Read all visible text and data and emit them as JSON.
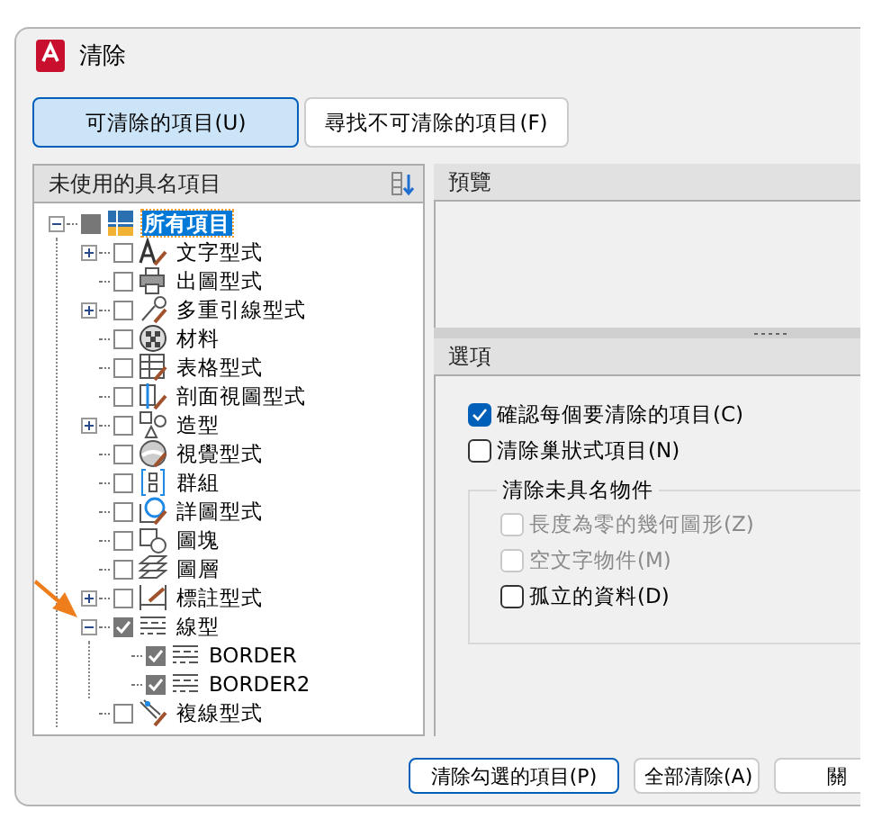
{
  "window": {
    "title": "清除"
  },
  "tabs": [
    {
      "label": "可清除的項目(U)",
      "selected": true
    },
    {
      "label": "尋找不可清除的項目(F)",
      "selected": false
    }
  ],
  "tree": {
    "header": "未使用的具名項目",
    "items": [
      {
        "label": "所有項目",
        "kind": "root",
        "checked": false,
        "indeterminate": true,
        "expanded": true,
        "selected": true,
        "children": [
          {
            "label": "文字型式",
            "kind": "text",
            "checked": false,
            "expanded": false,
            "selected": false
          },
          {
            "label": "出圖型式",
            "kind": "plot",
            "checked": false,
            "selected": false
          },
          {
            "label": "多重引線型式",
            "kind": "mleader",
            "checked": false,
            "expanded": false,
            "selected": false
          },
          {
            "label": "材料",
            "kind": "material",
            "checked": false,
            "selected": false
          },
          {
            "label": "表格型式",
            "kind": "table",
            "checked": false,
            "selected": false
          },
          {
            "label": "剖面視圖型式",
            "kind": "section",
            "checked": false,
            "selected": false
          },
          {
            "label": "造型",
            "kind": "shape",
            "checked": false,
            "expanded": false,
            "selected": false
          },
          {
            "label": "視覺型式",
            "kind": "visual",
            "checked": false,
            "selected": false
          },
          {
            "label": "群組",
            "kind": "group",
            "checked": false,
            "selected": false
          },
          {
            "label": "詳圖型式",
            "kind": "detail",
            "checked": false,
            "selected": false
          },
          {
            "label": "圖塊",
            "kind": "block",
            "checked": false,
            "selected": false
          },
          {
            "label": "圖層",
            "kind": "layer",
            "checked": false,
            "selected": false
          },
          {
            "label": "標註型式",
            "kind": "dim",
            "checked": false,
            "expanded": false,
            "selected": false
          },
          {
            "label": "線型",
            "kind": "linetype",
            "checked": true,
            "expanded": true,
            "selected": false,
            "children": [
              {
                "label": "BORDER",
                "kind": "linetype",
                "checked": true,
                "selected": false
              },
              {
                "label": "BORDER2",
                "kind": "linetype",
                "checked": true,
                "selected": false
              }
            ]
          },
          {
            "label": "複線型式",
            "kind": "mline",
            "checked": false,
            "selected": false
          }
        ]
      }
    ]
  },
  "preview": {
    "header": "預覽"
  },
  "options": {
    "header": "選項",
    "checks": [
      {
        "label": "確認每個要清除的項目(C)",
        "checked": true,
        "disabled": false
      },
      {
        "label": "清除巢狀式項目(N)",
        "checked": false,
        "disabled": false
      }
    ],
    "group": {
      "label": "清除未具名物件",
      "checks": [
        {
          "label": "長度為零的幾何圖形(Z)",
          "checked": false,
          "disabled": true
        },
        {
          "label": "空文字物件(M)",
          "checked": false,
          "disabled": true
        },
        {
          "label": "孤立的資料(D)",
          "checked": false,
          "disabled": false
        }
      ]
    }
  },
  "buttons": [
    {
      "label": "清除勾選的項目(P)",
      "selected": true
    },
    {
      "label": "全部清除(A)",
      "selected": false
    },
    {
      "label": "關",
      "selected": false
    }
  ]
}
